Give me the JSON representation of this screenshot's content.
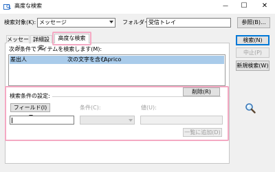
{
  "window": {
    "title": "高度な検索",
    "minimize": "—",
    "maximize": "☐",
    "close": "✕"
  },
  "top": {
    "scope_label": "検索対象(K):",
    "scope_value": "メッセージ",
    "folder_label": "フォルダー:",
    "folder_value": "受信トレイ",
    "browse_button": "参照(B)..."
  },
  "tabs": [
    {
      "label": "メッセージ"
    },
    {
      "label": "詳細設定"
    },
    {
      "label": "高度な検索"
    }
  ],
  "criteria": {
    "list_label": "次の条件でアイテムを検索します(M):",
    "columns": [
      "差出人",
      "次の文字を含む",
      "Aprico"
    ],
    "delete_button": "削除(R)"
  },
  "define": {
    "section_label": "検索条件の設定:",
    "field_button": "フィールド(I)",
    "condition_label": "条件(C):",
    "value_label": "値(U):",
    "add_button": "一覧に追加(D)"
  },
  "side_buttons": {
    "search": "検索(N)",
    "stop": "中止(P)",
    "new_search": "新規検索(W)"
  },
  "icons": {
    "app": "outlook-search-icon",
    "magnifier": "magnifier-icon"
  },
  "colors": {
    "highlight": "#f4a9c3",
    "selection": "#a9cbea",
    "accent": "#0078d7"
  }
}
